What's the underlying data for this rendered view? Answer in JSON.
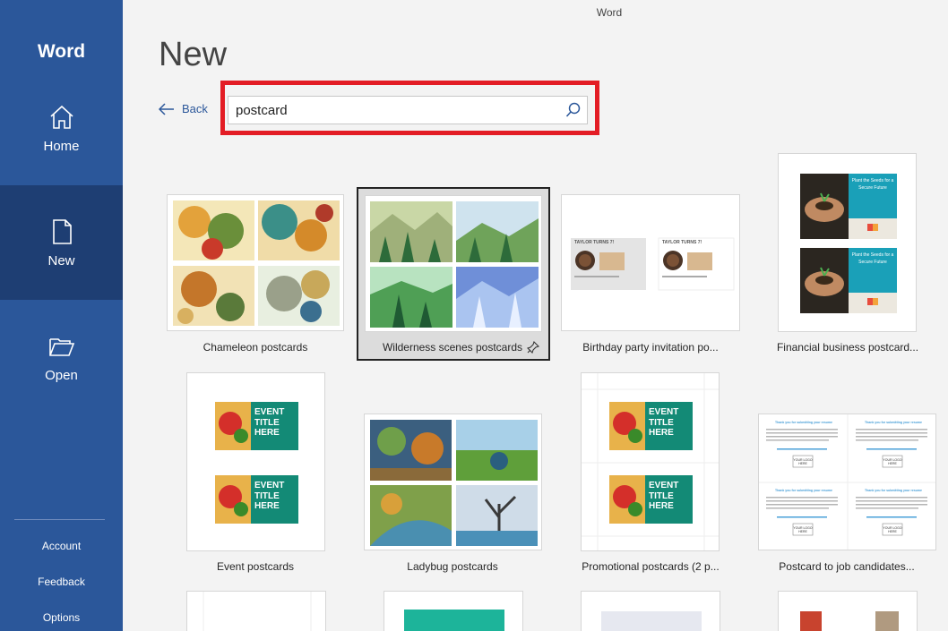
{
  "app": {
    "name": "Word",
    "window_title": "Word"
  },
  "nav": {
    "home": "Home",
    "new": "New",
    "open": "Open"
  },
  "side_links": {
    "account": "Account",
    "feedback": "Feedback",
    "options": "Options"
  },
  "page": {
    "title": "New",
    "back": "Back"
  },
  "search": {
    "value": "postcard"
  },
  "templates": [
    {
      "name": "Chameleon postcards"
    },
    {
      "name": "Wilderness scenes postcards",
      "selected": true
    },
    {
      "name": "Birthday party invitation po..."
    },
    {
      "name": "Financial business postcard..."
    },
    {
      "name": "Event postcards"
    },
    {
      "name": "Ladybug postcards"
    },
    {
      "name": "Promotional postcards (2 p..."
    },
    {
      "name": "Postcard to job candidates..."
    }
  ],
  "thumb_text": {
    "birthday": "TAYLOR TURNS 7!",
    "finance_headline": "Plant the Seeds for a Secure Future",
    "event_title": "EVENT TITLE HERE",
    "job_heading": "Thank you for submitting your resume",
    "job_logo": "YOUR LOGO HERE"
  },
  "colors": {
    "brand": "#2b579a",
    "brand_dark": "#1e3e73",
    "highlight": "#e31d25",
    "teal": "#0f8a77"
  }
}
